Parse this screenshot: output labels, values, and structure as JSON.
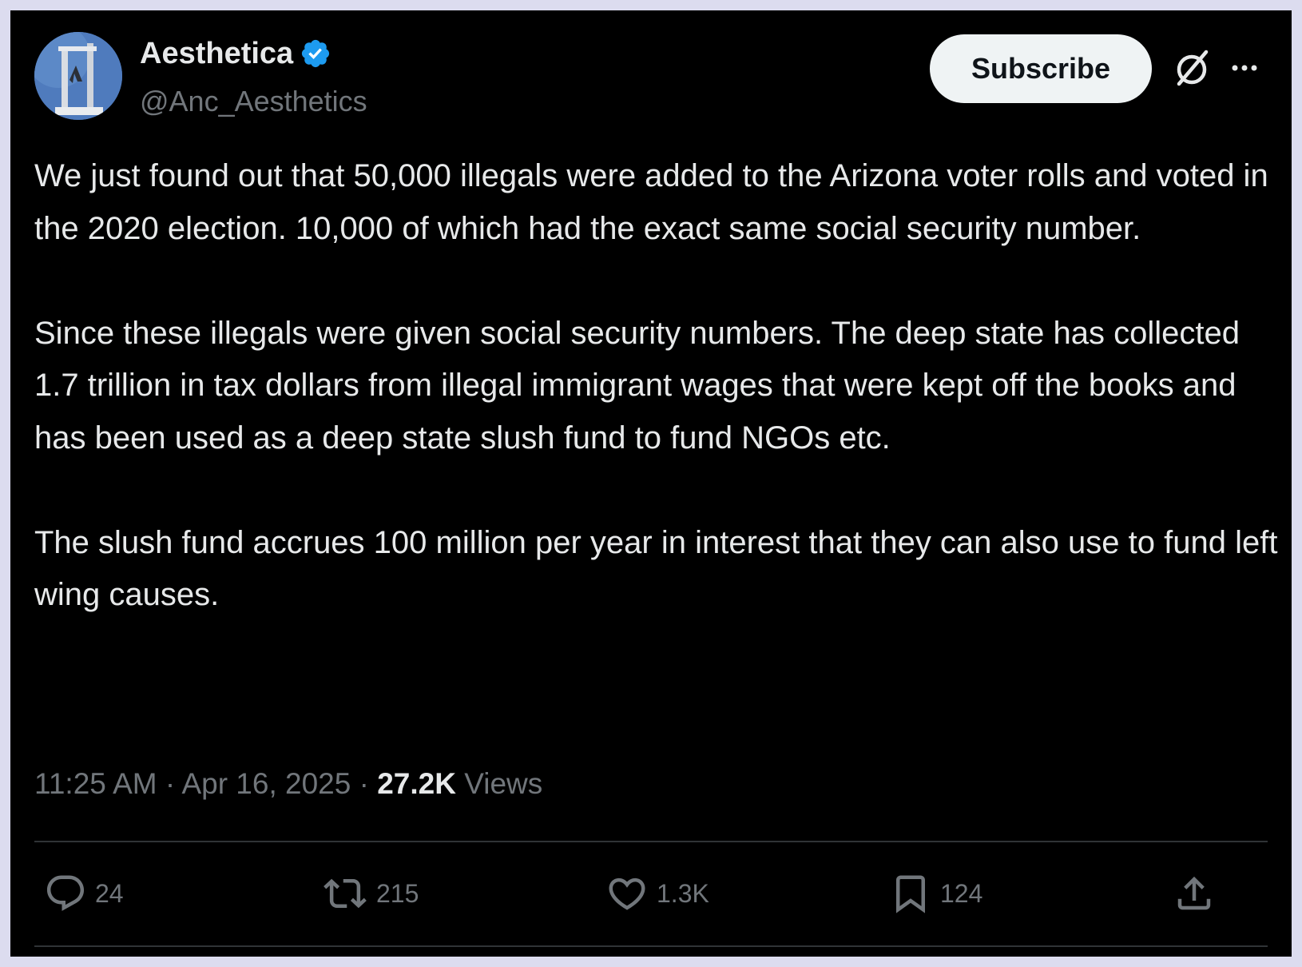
{
  "author": {
    "display_name": "Aesthetica",
    "handle": "@Anc_Aesthetics",
    "verified": true
  },
  "header": {
    "subscribe_label": "Subscribe"
  },
  "post": {
    "paragraphs": [
      "We just found out that 50,000 illegals were added to the Arizona voter rolls and voted in the 2020 election. 10,000 of which had the exact same social security number.",
      "Since these illegals were given social security numbers. The deep state has collected 1.7 trillion in tax dollars from illegal immigrant wages that were kept off the books and has been used as a deep state slush fund to fund NGOs etc.",
      "The slush fund accrues 100 million per year in interest that they can also use to fund left wing causes."
    ],
    "time": "11:25 AM",
    "separator": "·",
    "date": "Apr 16, 2025",
    "views_count": "27.2K",
    "views_label": "Views"
  },
  "actions": {
    "replies": "24",
    "reposts": "215",
    "likes": "1.3K",
    "bookmarks": "124"
  },
  "icons": {
    "verified": "verified-badge-icon",
    "grok": "grok-icon",
    "more": "more-icon",
    "reply": "reply-icon",
    "repost": "repost-icon",
    "like": "heart-icon",
    "bookmark": "bookmark-icon",
    "share": "share-icon"
  },
  "colors": {
    "background": "#000000",
    "frame": "#dcdcef",
    "text_primary": "#e7e9ea",
    "text_secondary": "#71767b",
    "verified_blue": "#1d9bf0",
    "divider": "#2f3336"
  }
}
